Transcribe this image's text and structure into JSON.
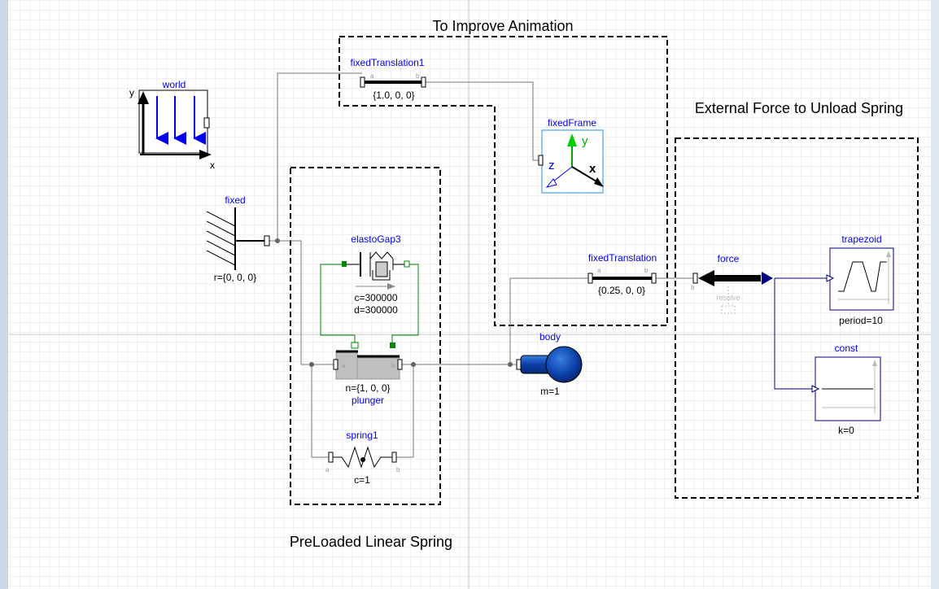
{
  "colors": {
    "name_label": "#0000ee",
    "wire": "#777777",
    "green_wire": "#008800",
    "dashed_box": "#000000",
    "frame_box_border": "#2a8ee0",
    "force_blue": "#000080"
  },
  "groups": {
    "animation": "To Improve Animation",
    "external_force": "External Force to Unload Spring",
    "preloaded": "PreLoaded Linear Spring"
  },
  "components": {
    "world": {
      "name": "world",
      "axis_x": "x",
      "axis_y": "y"
    },
    "fixed": {
      "name": "fixed",
      "param": "r={0, 0, 0}"
    },
    "fixedTranslation1": {
      "name": "fixedTranslation1",
      "param": "{1.0, 0, 0}",
      "port_a": "a",
      "port_b": "b"
    },
    "fixedFrame": {
      "name": "fixedFrame",
      "axis_x": "x",
      "axis_y": "y",
      "axis_z": "z"
    },
    "elastoGap3": {
      "name": "elastoGap3",
      "param_c": "c=300000",
      "param_d": "d=300000"
    },
    "plunger": {
      "name": "plunger",
      "param": "n={1, 0, 0}",
      "port_a": "a",
      "port_b": "b"
    },
    "spring1": {
      "name": "spring1",
      "param": "c=1",
      "port_a": "a",
      "port_b": "b"
    },
    "body": {
      "name": "body",
      "param": "m=1"
    },
    "fixedTranslation": {
      "name": "fixedTranslation",
      "param": "{0.25, 0, 0}",
      "port_a": "a",
      "port_b": "b"
    },
    "force": {
      "name": "force",
      "resolve": "resolve",
      "port_b": "b"
    },
    "trapezoid": {
      "name": "trapezoid",
      "param": "period=10"
    },
    "const": {
      "name": "const",
      "param": "k=0"
    }
  }
}
